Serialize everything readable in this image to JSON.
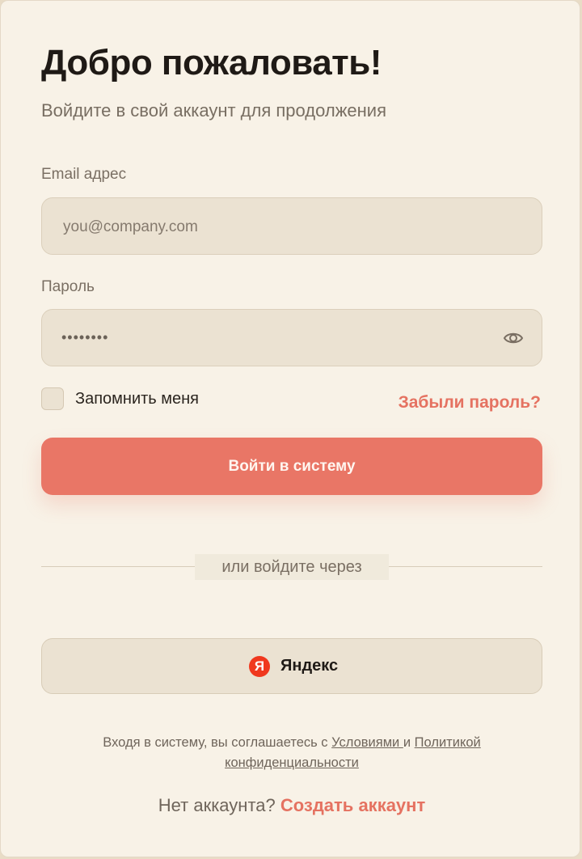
{
  "header": {
    "title": "Добро пожаловать!",
    "subtitle": "Войдите в свой аккаунт для продолжения"
  },
  "form": {
    "email_label": "Email адрес",
    "email_placeholder": "you@company.com",
    "email_value": "",
    "password_label": "Пароль",
    "password_value_masked": "••••••••",
    "password_toggle_icon": "eye-icon",
    "remember_label": "Запомнить меня",
    "remember_checked": false,
    "forgot_label": "Забыли пароль?",
    "submit_label": "Войти в систему"
  },
  "divider": {
    "label": "или войдите через"
  },
  "social": {
    "yandex_icon_letter": "Я",
    "yandex_label": "Яндекс"
  },
  "terms": {
    "prefix": "Входя в систему, вы соглашаетесь с ",
    "terms_link": "Условиями ",
    "and": " и ",
    "privacy_link": "Политикой конфиденциальности"
  },
  "signup": {
    "prompt": "Нет аккаунта? ",
    "link": "Создать аккаунт"
  },
  "colors": {
    "accent": "#e97666",
    "background": "#f8f2e7",
    "field": "#ebe2d2",
    "yandex": "#f0381e"
  }
}
